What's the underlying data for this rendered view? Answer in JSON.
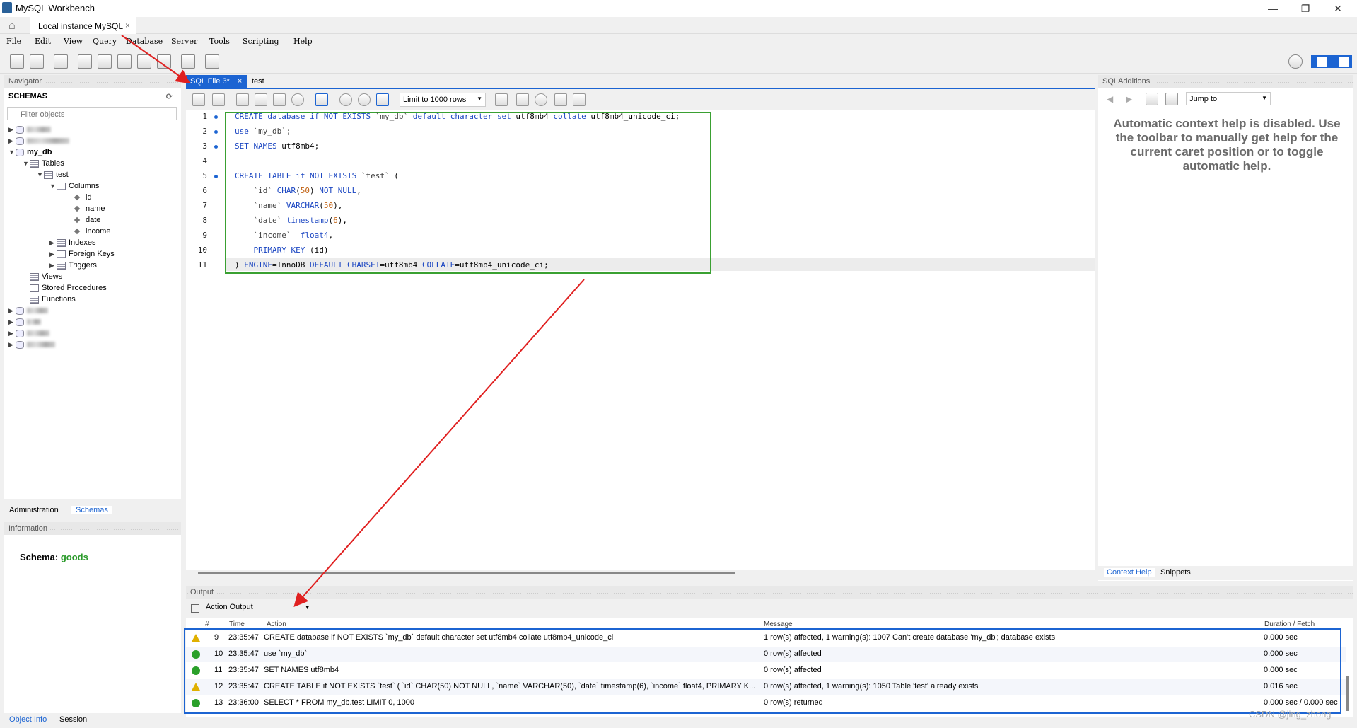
{
  "window": {
    "title": "MySQL Workbench",
    "minimize": "—",
    "maximize": "❐",
    "close": "✕"
  },
  "connection_tab": {
    "label": "Local instance MySQL",
    "close": "×"
  },
  "menu": [
    "File",
    "Edit",
    "View",
    "Query",
    "Database",
    "Server",
    "Tools",
    "Scripting",
    "Help"
  ],
  "navigator": {
    "header": "Navigator",
    "schemas_label": "SCHEMAS",
    "filter_placeholder": "Filter objects",
    "db": "my_db",
    "tables": "Tables",
    "table": "test",
    "columns_label": "Columns",
    "columns": [
      "id",
      "name",
      "date",
      "income"
    ],
    "indexes": "Indexes",
    "foreign_keys": "Foreign Keys",
    "triggers": "Triggers",
    "views": "Views",
    "stored_procedures": "Stored Procedures",
    "functions": "Functions"
  },
  "nav_tabs": {
    "administration": "Administration",
    "schemas": "Schemas"
  },
  "information": {
    "header": "Information",
    "schema_label": "Schema:",
    "schema_value": "goods"
  },
  "bottom_tabs": {
    "object_info": "Object Info",
    "session": "Session"
  },
  "editor_tabs": {
    "active": "SQL File 3*",
    "active_close": "×",
    "other": "test"
  },
  "editor_toolbar": {
    "limit": "Limit to 1000 rows"
  },
  "code_lines": [
    {
      "n": "1",
      "text": "CREATE database if NOT EXISTS `my_db` default character set utf8mb4 collate utf8mb4_unicode_ci;"
    },
    {
      "n": "2",
      "text": "use `my_db`;"
    },
    {
      "n": "3",
      "text": "SET NAMES utf8mb4;"
    },
    {
      "n": "4",
      "text": ""
    },
    {
      "n": "5",
      "text": "CREATE TABLE if NOT EXISTS `test` ("
    },
    {
      "n": "6",
      "text": "    `id` CHAR(50) NOT NULL,"
    },
    {
      "n": "7",
      "text": "    `name` VARCHAR(50),"
    },
    {
      "n": "8",
      "text": "    `date` timestamp(6),"
    },
    {
      "n": "9",
      "text": "    `income`  float4,"
    },
    {
      "n": "10",
      "text": "    PRIMARY KEY (id)"
    },
    {
      "n": "11",
      "text": ") ENGINE=InnoDB DEFAULT CHARSET=utf8mb4 COLLATE=utf8mb4_unicode_ci;"
    }
  ],
  "sql_additions": {
    "header": "SQLAdditions",
    "jump_to": "Jump to",
    "help_text": "Automatic context help is disabled. Use the toolbar to manually get help for the current caret position or to toggle automatic help.",
    "tab_context": "Context Help",
    "tab_snippets": "Snippets"
  },
  "output": {
    "header": "Output",
    "selector": "Action Output",
    "columns": {
      "num": "#",
      "time": "Time",
      "action": "Action",
      "message": "Message",
      "duration": "Duration / Fetch"
    },
    "rows": [
      {
        "status": "warning",
        "num": "9",
        "time": "23:35:47",
        "action": "CREATE database if NOT EXISTS `my_db` default character set utf8mb4 collate utf8mb4_unicode_ci",
        "message": "1 row(s) affected, 1 warning(s): 1007 Can't create database 'my_db'; database exists",
        "duration": "0.000 sec"
      },
      {
        "status": "ok",
        "num": "10",
        "time": "23:35:47",
        "action": "use `my_db`",
        "message": "0 row(s) affected",
        "duration": "0.000 sec"
      },
      {
        "status": "ok",
        "num": "11",
        "time": "23:35:47",
        "action": "SET NAMES utf8mb4",
        "message": "0 row(s) affected",
        "duration": "0.000 sec"
      },
      {
        "status": "warning",
        "num": "12",
        "time": "23:35:47",
        "action": "CREATE TABLE if NOT EXISTS `test` ( `id` CHAR(50) NOT NULL, `name` VARCHAR(50),     `date` timestamp(6),     `income` float4, PRIMARY K...",
        "message": "0 row(s) affected, 1 warning(s): 1050 Table 'test' already exists",
        "duration": "0.016 sec"
      },
      {
        "status": "ok",
        "num": "13",
        "time": "23:36:00",
        "action": "SELECT * FROM my_db.test LIMIT 0, 1000",
        "message": "0 row(s) returned",
        "duration": "0.000 sec / 0.000 sec"
      }
    ]
  },
  "watermark": "CSDN @jing_zhong",
  "colors": {
    "accent": "#1c64d2",
    "annotation_red": "#e02020",
    "highlight_green": "#3aa032",
    "schema_green": "#2a9a2a"
  }
}
